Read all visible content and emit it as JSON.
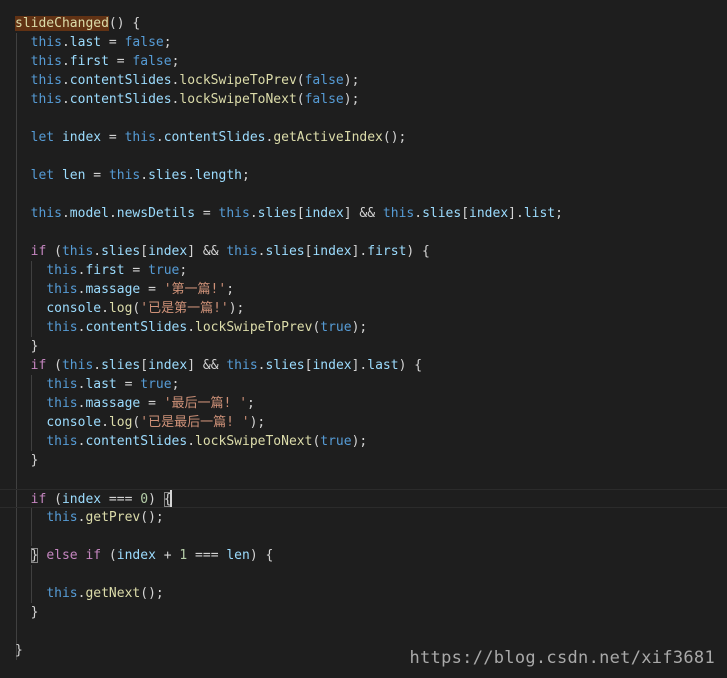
{
  "lines": [
    [
      [
        "fn",
        "slideChanged",
        "hl"
      ],
      [
        "pun",
        "() {"
      ]
    ],
    [
      [
        "ws",
        "  "
      ],
      [
        "kw",
        "this"
      ],
      [
        "pun",
        "."
      ],
      [
        "var",
        "last"
      ],
      [
        "pun",
        " = "
      ],
      [
        "kw",
        "false"
      ],
      [
        "pun",
        ";"
      ]
    ],
    [
      [
        "ws",
        "  "
      ],
      [
        "kw",
        "this"
      ],
      [
        "pun",
        "."
      ],
      [
        "var",
        "first"
      ],
      [
        "pun",
        " = "
      ],
      [
        "kw",
        "false"
      ],
      [
        "pun",
        ";"
      ]
    ],
    [
      [
        "ws",
        "  "
      ],
      [
        "kw",
        "this"
      ],
      [
        "pun",
        "."
      ],
      [
        "var",
        "contentSlides"
      ],
      [
        "pun",
        "."
      ],
      [
        "fn",
        "lockSwipeToPrev"
      ],
      [
        "pun",
        "("
      ],
      [
        "kw",
        "false"
      ],
      [
        "pun",
        ");"
      ]
    ],
    [
      [
        "ws",
        "  "
      ],
      [
        "kw",
        "this"
      ],
      [
        "pun",
        "."
      ],
      [
        "var",
        "contentSlides"
      ],
      [
        "pun",
        "."
      ],
      [
        "fn",
        "lockSwipeToNext"
      ],
      [
        "pun",
        "("
      ],
      [
        "kw",
        "false"
      ],
      [
        "pun",
        ");"
      ]
    ],
    [],
    [
      [
        "ws",
        "  "
      ],
      [
        "kw",
        "let"
      ],
      [
        "pun",
        " "
      ],
      [
        "var",
        "index"
      ],
      [
        "pun",
        " = "
      ],
      [
        "kw",
        "this"
      ],
      [
        "pun",
        "."
      ],
      [
        "var",
        "contentSlides"
      ],
      [
        "pun",
        "."
      ],
      [
        "fn",
        "getActiveIndex"
      ],
      [
        "pun",
        "();"
      ]
    ],
    [],
    [
      [
        "ws",
        "  "
      ],
      [
        "kw",
        "let"
      ],
      [
        "pun",
        " "
      ],
      [
        "var",
        "len"
      ],
      [
        "pun",
        " = "
      ],
      [
        "kw",
        "this"
      ],
      [
        "pun",
        "."
      ],
      [
        "var",
        "slies"
      ],
      [
        "pun",
        "."
      ],
      [
        "var",
        "length"
      ],
      [
        "pun",
        ";"
      ]
    ],
    [],
    [
      [
        "ws",
        "  "
      ],
      [
        "kw",
        "this"
      ],
      [
        "pun",
        "."
      ],
      [
        "var",
        "model"
      ],
      [
        "pun",
        "."
      ],
      [
        "var",
        "newsDetils"
      ],
      [
        "pun",
        " = "
      ],
      [
        "kw",
        "this"
      ],
      [
        "pun",
        "."
      ],
      [
        "var",
        "slies"
      ],
      [
        "pun",
        "["
      ],
      [
        "var",
        "index"
      ],
      [
        "pun",
        "] && "
      ],
      [
        "kw",
        "this"
      ],
      [
        "pun",
        "."
      ],
      [
        "var",
        "slies"
      ],
      [
        "pun",
        "["
      ],
      [
        "var",
        "index"
      ],
      [
        "pun",
        "]."
      ],
      [
        "var",
        "list"
      ],
      [
        "pun",
        ";"
      ]
    ],
    [],
    [
      [
        "ws",
        "  "
      ],
      [
        "ctl",
        "if"
      ],
      [
        "pun",
        " ("
      ],
      [
        "kw",
        "this"
      ],
      [
        "pun",
        "."
      ],
      [
        "var",
        "slies"
      ],
      [
        "pun",
        "["
      ],
      [
        "var",
        "index"
      ],
      [
        "pun",
        "] && "
      ],
      [
        "kw",
        "this"
      ],
      [
        "pun",
        "."
      ],
      [
        "var",
        "slies"
      ],
      [
        "pun",
        "["
      ],
      [
        "var",
        "index"
      ],
      [
        "pun",
        "]."
      ],
      [
        "var",
        "first"
      ],
      [
        "pun",
        ") {"
      ]
    ],
    [
      [
        "ws",
        "    "
      ],
      [
        "kw",
        "this"
      ],
      [
        "pun",
        "."
      ],
      [
        "var",
        "first"
      ],
      [
        "pun",
        " = "
      ],
      [
        "kw",
        "true"
      ],
      [
        "pun",
        ";"
      ]
    ],
    [
      [
        "ws",
        "    "
      ],
      [
        "kw",
        "this"
      ],
      [
        "pun",
        "."
      ],
      [
        "var",
        "massage"
      ],
      [
        "pun",
        " = "
      ],
      [
        "str",
        "'第一篇!'"
      ],
      [
        "pun",
        ";"
      ]
    ],
    [
      [
        "ws",
        "    "
      ],
      [
        "var",
        "console"
      ],
      [
        "pun",
        "."
      ],
      [
        "fn",
        "log"
      ],
      [
        "pun",
        "("
      ],
      [
        "str",
        "'已是第一篇!'"
      ],
      [
        "pun",
        ");"
      ]
    ],
    [
      [
        "ws",
        "    "
      ],
      [
        "kw",
        "this"
      ],
      [
        "pun",
        "."
      ],
      [
        "var",
        "contentSlides"
      ],
      [
        "pun",
        "."
      ],
      [
        "fn",
        "lockSwipeToPrev"
      ],
      [
        "pun",
        "("
      ],
      [
        "kw",
        "true"
      ],
      [
        "pun",
        ");"
      ]
    ],
    [
      [
        "ws",
        "  "
      ],
      [
        "pun",
        "}"
      ]
    ],
    [
      [
        "ws",
        "  "
      ],
      [
        "ctl",
        "if"
      ],
      [
        "pun",
        " ("
      ],
      [
        "kw",
        "this"
      ],
      [
        "pun",
        "."
      ],
      [
        "var",
        "slies"
      ],
      [
        "pun",
        "["
      ],
      [
        "var",
        "index"
      ],
      [
        "pun",
        "] && "
      ],
      [
        "kw",
        "this"
      ],
      [
        "pun",
        "."
      ],
      [
        "var",
        "slies"
      ],
      [
        "pun",
        "["
      ],
      [
        "var",
        "index"
      ],
      [
        "pun",
        "]."
      ],
      [
        "var",
        "last"
      ],
      [
        "pun",
        ") {"
      ]
    ],
    [
      [
        "ws",
        "    "
      ],
      [
        "kw",
        "this"
      ],
      [
        "pun",
        "."
      ],
      [
        "var",
        "last"
      ],
      [
        "pun",
        " = "
      ],
      [
        "kw",
        "true"
      ],
      [
        "pun",
        ";"
      ]
    ],
    [
      [
        "ws",
        "    "
      ],
      [
        "kw",
        "this"
      ],
      [
        "pun",
        "."
      ],
      [
        "var",
        "massage"
      ],
      [
        "pun",
        " = "
      ],
      [
        "str",
        "'最后一篇! '"
      ],
      [
        "pun",
        ";"
      ]
    ],
    [
      [
        "ws",
        "    "
      ],
      [
        "var",
        "console"
      ],
      [
        "pun",
        "."
      ],
      [
        "fn",
        "log"
      ],
      [
        "pun",
        "("
      ],
      [
        "str",
        "'已是最后一篇! '"
      ],
      [
        "pun",
        ");"
      ]
    ],
    [
      [
        "ws",
        "    "
      ],
      [
        "kw",
        "this"
      ],
      [
        "pun",
        "."
      ],
      [
        "var",
        "contentSlides"
      ],
      [
        "pun",
        "."
      ],
      [
        "fn",
        "lockSwipeToNext"
      ],
      [
        "pun",
        "("
      ],
      [
        "kw",
        "true"
      ],
      [
        "pun",
        ");"
      ]
    ],
    [
      [
        "ws",
        "  "
      ],
      [
        "pun",
        "}"
      ]
    ],
    [],
    [
      [
        "ws",
        "  "
      ],
      [
        "ctl",
        "if"
      ],
      [
        "pun",
        " ("
      ],
      [
        "var",
        "index"
      ],
      [
        "pun",
        " === "
      ],
      [
        "num",
        "0"
      ],
      [
        "pun",
        ") "
      ],
      [
        "pun",
        "{",
        "box"
      ]
    ],
    [
      [
        "ws",
        "    "
      ],
      [
        "kw",
        "this"
      ],
      [
        "pun",
        "."
      ],
      [
        "fn",
        "getPrev"
      ],
      [
        "pun",
        "();"
      ]
    ],
    [],
    [
      [
        "ws",
        "  "
      ],
      [
        "pun",
        "}",
        "box"
      ],
      [
        "pun",
        " "
      ],
      [
        "ctl",
        "else"
      ],
      [
        "pun",
        " "
      ],
      [
        "ctl",
        "if"
      ],
      [
        "pun",
        " ("
      ],
      [
        "var",
        "index"
      ],
      [
        "pun",
        " + "
      ],
      [
        "num",
        "1"
      ],
      [
        "pun",
        " === "
      ],
      [
        "var",
        "len"
      ],
      [
        "pun",
        ") {"
      ]
    ],
    [],
    [
      [
        "ws",
        "    "
      ],
      [
        "kw",
        "this"
      ],
      [
        "pun",
        "."
      ],
      [
        "fn",
        "getNext"
      ],
      [
        "pun",
        "();"
      ]
    ],
    [
      [
        "ws",
        "  "
      ],
      [
        "pun",
        "}"
      ]
    ],
    [],
    [
      [
        "ws",
        ""
      ],
      [
        "pun",
        "}"
      ]
    ]
  ],
  "watermark": "https://blog.csdn.net/xif3681",
  "colors": {
    "background": "#1e1e1e",
    "keyword": "#569cd6",
    "control": "#c586c0",
    "variable": "#9cdcfe",
    "function": "#dcdcaa",
    "string": "#ce9178",
    "number": "#b5cea8",
    "punctuation": "#d4d4d4"
  }
}
